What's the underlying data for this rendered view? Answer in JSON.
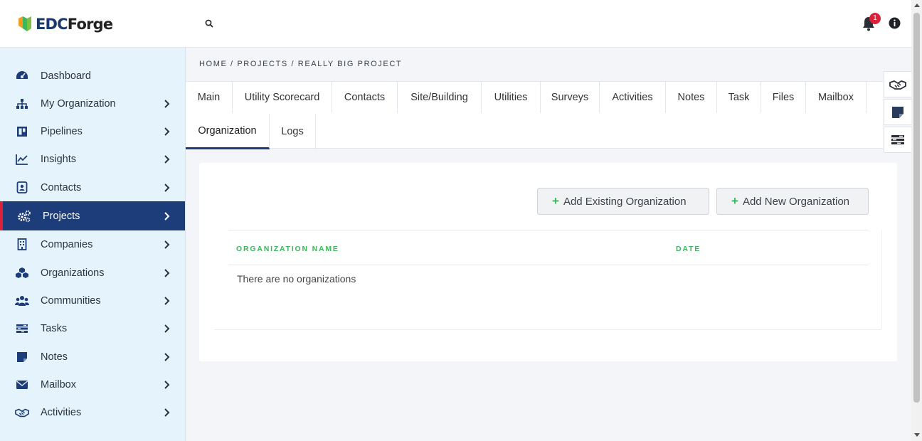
{
  "header": {
    "logo_text_a": "EDC",
    "logo_text_b": "Forge",
    "notification_count": "1"
  },
  "sidebar": {
    "items": [
      {
        "label": "Dashboard",
        "icon": "dashboard-icon"
      },
      {
        "label": "My Organization",
        "icon": "org-chart-icon"
      },
      {
        "label": "Pipelines",
        "icon": "pipeline-board-icon"
      },
      {
        "label": "Insights",
        "icon": "line-chart-icon"
      },
      {
        "label": "Contacts",
        "icon": "contact-card-icon"
      },
      {
        "label": "Projects",
        "icon": "gears-icon"
      },
      {
        "label": "Companies",
        "icon": "building-icon"
      },
      {
        "label": "Organizations",
        "icon": "cubes-icon"
      },
      {
        "label": "Communities",
        "icon": "users-icon"
      },
      {
        "label": "Tasks",
        "icon": "tasks-icon"
      },
      {
        "label": "Notes",
        "icon": "sticky-note-icon"
      },
      {
        "label": "Mailbox",
        "icon": "envelope-icon"
      },
      {
        "label": "Activities",
        "icon": "handshake-icon"
      }
    ],
    "active": "Projects"
  },
  "breadcrumb": "HOME / PROJECTS / REALLY BIG PROJECT",
  "tabs": {
    "row1": [
      "Main",
      "Utility Scorecard",
      "Contacts",
      "Site/Building",
      "Utilities",
      "Surveys",
      "Activities",
      "Notes",
      "Task",
      "Files",
      "Mailbox"
    ],
    "row2": [
      "Organization",
      "Logs"
    ],
    "active": "Organization"
  },
  "actions": {
    "add_existing": "Add Existing Organization",
    "add_new": "Add New Organization"
  },
  "table": {
    "columns": [
      "ORGANIZATION NAME",
      "DATE"
    ],
    "empty_message": "There are no organizations"
  },
  "colors": {
    "primary": "#1c3d7a",
    "accent_red": "#d9213a",
    "green": "#3bb85d",
    "sidebar_bg": "#e5f3fc"
  }
}
